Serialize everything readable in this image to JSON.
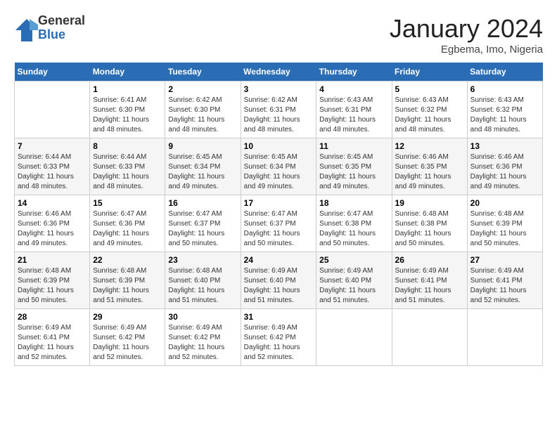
{
  "logo": {
    "general": "General",
    "blue": "Blue"
  },
  "title": "January 2024",
  "subtitle": "Egbema, Imo, Nigeria",
  "days_of_week": [
    "Sunday",
    "Monday",
    "Tuesday",
    "Wednesday",
    "Thursday",
    "Friday",
    "Saturday"
  ],
  "weeks": [
    [
      {
        "day": "",
        "sunrise": "",
        "sunset": "",
        "daylight": ""
      },
      {
        "day": "1",
        "sunrise": "Sunrise: 6:41 AM",
        "sunset": "Sunset: 6:30 PM",
        "daylight": "Daylight: 11 hours and 48 minutes."
      },
      {
        "day": "2",
        "sunrise": "Sunrise: 6:42 AM",
        "sunset": "Sunset: 6:30 PM",
        "daylight": "Daylight: 11 hours and 48 minutes."
      },
      {
        "day": "3",
        "sunrise": "Sunrise: 6:42 AM",
        "sunset": "Sunset: 6:31 PM",
        "daylight": "Daylight: 11 hours and 48 minutes."
      },
      {
        "day": "4",
        "sunrise": "Sunrise: 6:43 AM",
        "sunset": "Sunset: 6:31 PM",
        "daylight": "Daylight: 11 hours and 48 minutes."
      },
      {
        "day": "5",
        "sunrise": "Sunrise: 6:43 AM",
        "sunset": "Sunset: 6:32 PM",
        "daylight": "Daylight: 11 hours and 48 minutes."
      },
      {
        "day": "6",
        "sunrise": "Sunrise: 6:43 AM",
        "sunset": "Sunset: 6:32 PM",
        "daylight": "Daylight: 11 hours and 48 minutes."
      }
    ],
    [
      {
        "day": "7",
        "sunrise": "Sunrise: 6:44 AM",
        "sunset": "Sunset: 6:33 PM",
        "daylight": "Daylight: 11 hours and 48 minutes."
      },
      {
        "day": "8",
        "sunrise": "Sunrise: 6:44 AM",
        "sunset": "Sunset: 6:33 PM",
        "daylight": "Daylight: 11 hours and 48 minutes."
      },
      {
        "day": "9",
        "sunrise": "Sunrise: 6:45 AM",
        "sunset": "Sunset: 6:34 PM",
        "daylight": "Daylight: 11 hours and 49 minutes."
      },
      {
        "day": "10",
        "sunrise": "Sunrise: 6:45 AM",
        "sunset": "Sunset: 6:34 PM",
        "daylight": "Daylight: 11 hours and 49 minutes."
      },
      {
        "day": "11",
        "sunrise": "Sunrise: 6:45 AM",
        "sunset": "Sunset: 6:35 PM",
        "daylight": "Daylight: 11 hours and 49 minutes."
      },
      {
        "day": "12",
        "sunrise": "Sunrise: 6:46 AM",
        "sunset": "Sunset: 6:35 PM",
        "daylight": "Daylight: 11 hours and 49 minutes."
      },
      {
        "day": "13",
        "sunrise": "Sunrise: 6:46 AM",
        "sunset": "Sunset: 6:36 PM",
        "daylight": "Daylight: 11 hours and 49 minutes."
      }
    ],
    [
      {
        "day": "14",
        "sunrise": "Sunrise: 6:46 AM",
        "sunset": "Sunset: 6:36 PM",
        "daylight": "Daylight: 11 hours and 49 minutes."
      },
      {
        "day": "15",
        "sunrise": "Sunrise: 6:47 AM",
        "sunset": "Sunset: 6:36 PM",
        "daylight": "Daylight: 11 hours and 49 minutes."
      },
      {
        "day": "16",
        "sunrise": "Sunrise: 6:47 AM",
        "sunset": "Sunset: 6:37 PM",
        "daylight": "Daylight: 11 hours and 50 minutes."
      },
      {
        "day": "17",
        "sunrise": "Sunrise: 6:47 AM",
        "sunset": "Sunset: 6:37 PM",
        "daylight": "Daylight: 11 hours and 50 minutes."
      },
      {
        "day": "18",
        "sunrise": "Sunrise: 6:47 AM",
        "sunset": "Sunset: 6:38 PM",
        "daylight": "Daylight: 11 hours and 50 minutes."
      },
      {
        "day": "19",
        "sunrise": "Sunrise: 6:48 AM",
        "sunset": "Sunset: 6:38 PM",
        "daylight": "Daylight: 11 hours and 50 minutes."
      },
      {
        "day": "20",
        "sunrise": "Sunrise: 6:48 AM",
        "sunset": "Sunset: 6:39 PM",
        "daylight": "Daylight: 11 hours and 50 minutes."
      }
    ],
    [
      {
        "day": "21",
        "sunrise": "Sunrise: 6:48 AM",
        "sunset": "Sunset: 6:39 PM",
        "daylight": "Daylight: 11 hours and 50 minutes."
      },
      {
        "day": "22",
        "sunrise": "Sunrise: 6:48 AM",
        "sunset": "Sunset: 6:39 PM",
        "daylight": "Daylight: 11 hours and 51 minutes."
      },
      {
        "day": "23",
        "sunrise": "Sunrise: 6:48 AM",
        "sunset": "Sunset: 6:40 PM",
        "daylight": "Daylight: 11 hours and 51 minutes."
      },
      {
        "day": "24",
        "sunrise": "Sunrise: 6:49 AM",
        "sunset": "Sunset: 6:40 PM",
        "daylight": "Daylight: 11 hours and 51 minutes."
      },
      {
        "day": "25",
        "sunrise": "Sunrise: 6:49 AM",
        "sunset": "Sunset: 6:40 PM",
        "daylight": "Daylight: 11 hours and 51 minutes."
      },
      {
        "day": "26",
        "sunrise": "Sunrise: 6:49 AM",
        "sunset": "Sunset: 6:41 PM",
        "daylight": "Daylight: 11 hours and 51 minutes."
      },
      {
        "day": "27",
        "sunrise": "Sunrise: 6:49 AM",
        "sunset": "Sunset: 6:41 PM",
        "daylight": "Daylight: 11 hours and 52 minutes."
      }
    ],
    [
      {
        "day": "28",
        "sunrise": "Sunrise: 6:49 AM",
        "sunset": "Sunset: 6:41 PM",
        "daylight": "Daylight: 11 hours and 52 minutes."
      },
      {
        "day": "29",
        "sunrise": "Sunrise: 6:49 AM",
        "sunset": "Sunset: 6:42 PM",
        "daylight": "Daylight: 11 hours and 52 minutes."
      },
      {
        "day": "30",
        "sunrise": "Sunrise: 6:49 AM",
        "sunset": "Sunset: 6:42 PM",
        "daylight": "Daylight: 11 hours and 52 minutes."
      },
      {
        "day": "31",
        "sunrise": "Sunrise: 6:49 AM",
        "sunset": "Sunset: 6:42 PM",
        "daylight": "Daylight: 11 hours and 52 minutes."
      },
      {
        "day": "",
        "sunrise": "",
        "sunset": "",
        "daylight": ""
      },
      {
        "day": "",
        "sunrise": "",
        "sunset": "",
        "daylight": ""
      },
      {
        "day": "",
        "sunrise": "",
        "sunset": "",
        "daylight": ""
      }
    ]
  ]
}
